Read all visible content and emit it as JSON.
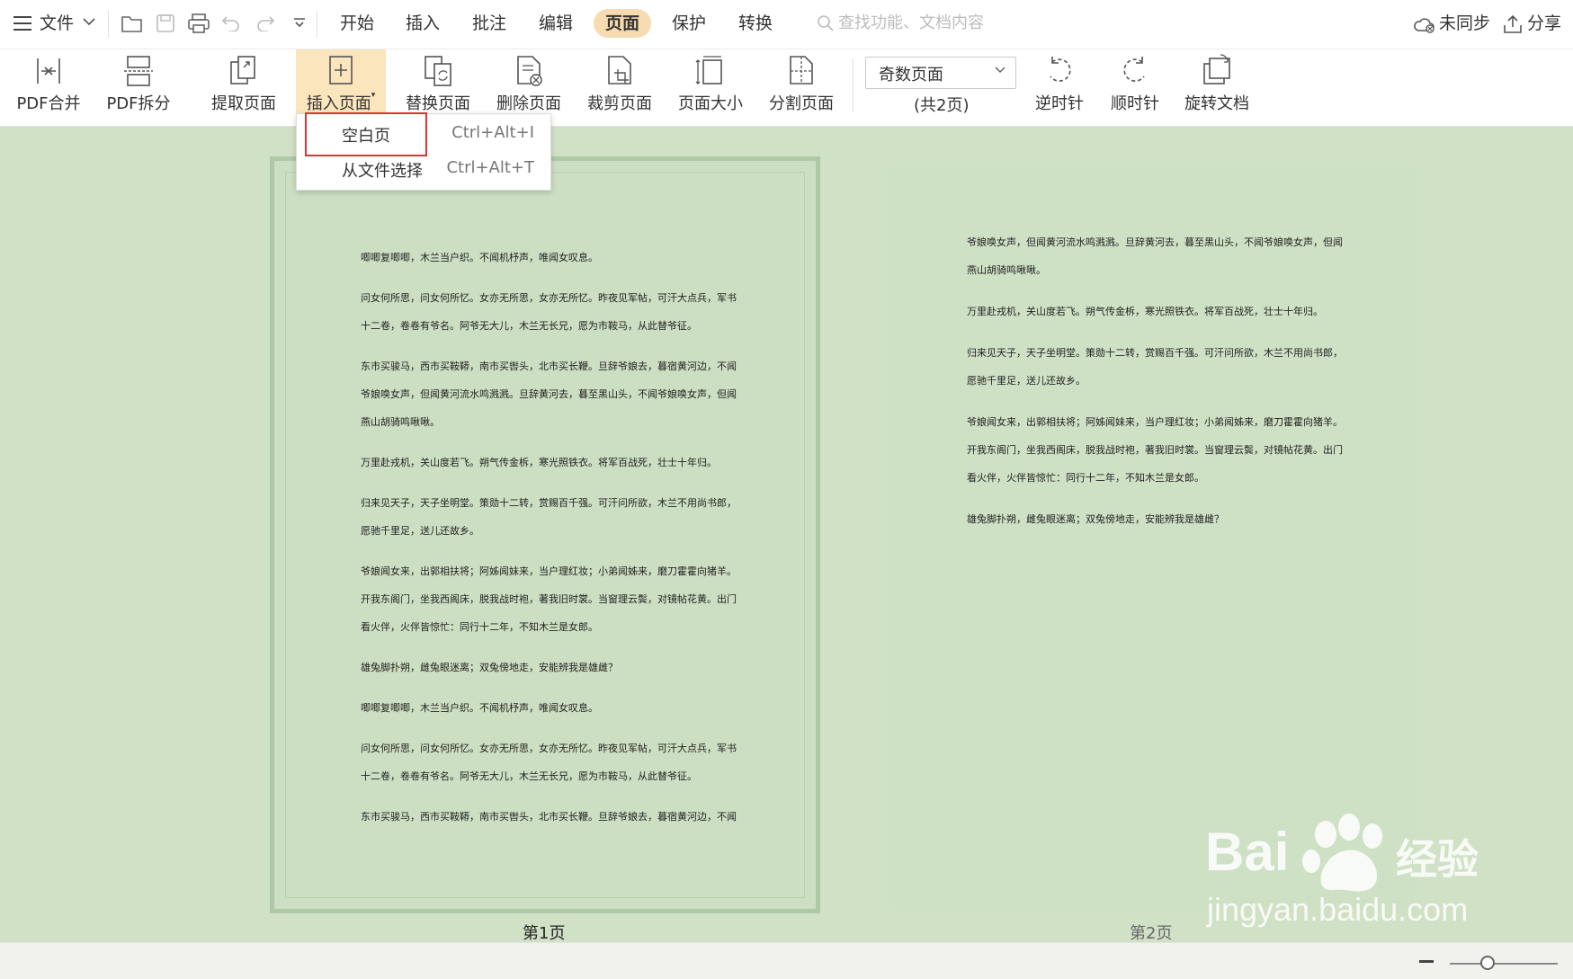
{
  "topbar": {
    "file_label": "文件",
    "tabs": [
      "开始",
      "插入",
      "批注",
      "编辑",
      "页面",
      "保护",
      "转换"
    ],
    "search_placeholder": "查找功能、文档内容",
    "sync_label": "未同步",
    "share_label": "分享"
  },
  "ribbon": {
    "buttons": [
      "PDF合并",
      "PDF拆分",
      "提取页面",
      "插入页面",
      "替换页面",
      "删除页面",
      "裁剪页面",
      "页面大小",
      "分割页面"
    ],
    "page_select_value": "奇数页面",
    "page_count": "(共2页)",
    "rotate_buttons": [
      "逆时针",
      "顺时针",
      "旋转文档"
    ]
  },
  "insert_menu": {
    "items": [
      {
        "label": "空白页",
        "shortcut": "Ctrl+Alt+I"
      },
      {
        "label": "从文件选择",
        "shortcut": "Ctrl+Alt+T"
      }
    ]
  },
  "page1": {
    "label": "第1页",
    "lines": [
      "唧唧复唧唧，木兰当户织。不闻机杼声，唯闻女叹息。",
      "问女何所思，问女何所忆。女亦无所思，女亦无所忆。昨夜见军帖，可汗大点兵，军书",
      "十二卷，卷卷有爷名。阿爷无大儿，木兰无长兄，愿为市鞍马，从此替爷征。",
      "东市买骏马，西市买鞍鞯，南市买辔头，北市买长鞭。旦辞爷娘去，暮宿黄河边，不闻",
      "爷娘唤女声，但闻黄河流水鸣溅溅。旦辞黄河去，暮至黑山头，不闻爷娘唤女声，但闻",
      "燕山胡骑鸣啾啾。",
      "万里赴戎机，关山度若飞。朔气传金柝，寒光照铁衣。将军百战死，壮士十年归。",
      "归来见天子，天子坐明堂。策勋十二转，赏赐百千强。可汗问所欲，木兰不用尚书郎，",
      "愿驰千里足，送儿还故乡。",
      "爷娘闻女来，出郭相扶将；阿姊闻妹来，当户理红妆；小弟闻姊来，磨刀霍霍向猪羊。",
      "开我东阁门，坐我西阁床，脱我战时袍，著我旧时裳。当窗理云鬓，对镜帖花黄。出门",
      "看火伴，火伴皆惊忙：同行十二年，不知木兰是女郎。",
      "雄兔脚扑朔，雌兔眼迷离；双兔傍地走，安能辨我是雄雌？",
      "唧唧复唧唧，木兰当户织。不闻机杼声，唯闻女叹息。",
      "问女何所思，问女何所忆。女亦无所思，女亦无所忆。昨夜见军帖，可汗大点兵，军书",
      "十二卷，卷卷有爷名。阿爷无大儿，木兰无长兄，愿为市鞍马，从此替爷征。",
      "东市买骏马，西市买鞍鞯，南市买辔头，北市买长鞭。旦辞爷娘去，暮宿黄河边，不闻"
    ]
  },
  "page2": {
    "label": "第2页",
    "lines": [
      "爷娘唤女声，但闻黄河流水鸣溅溅。旦辞黄河去，暮至黑山头，不闻爷娘唤女声，但闻",
      "燕山胡骑鸣啾啾。",
      "万里赴戎机，关山度若飞。朔气传金柝，寒光照铁衣。将军百战死，壮士十年归。",
      "归来见天子，天子坐明堂。策勋十二转，赏赐百千强。可汗问所欲，木兰不用尚书郎，",
      "愿驰千里足，送儿还故乡。",
      "爷娘闻女来，出郭相扶将；阿姊闻妹来，当户理红妆；小弟闻姊来，磨刀霍霍向猪羊。",
      "开我东阁门，坐我西阁床，脱我战时袍，著我旧时裳。当窗理云鬓，对镜帖花黄。出门",
      "看火伴，火伴皆惊忙：同行十二年，不知木兰是女郎。",
      "雄兔脚扑朔，雌兔眼迷离；双兔傍地走，安能辨我是雄雌？"
    ]
  },
  "watermark": {
    "brand": "Bai du 经验",
    "url": "jingyan.baidu.com"
  },
  "colors": {
    "canvas": "#d1e1c6",
    "active_tab": "#f6dcb0",
    "active_button": "#fbe5bd",
    "highlight_box": "#e03232"
  }
}
